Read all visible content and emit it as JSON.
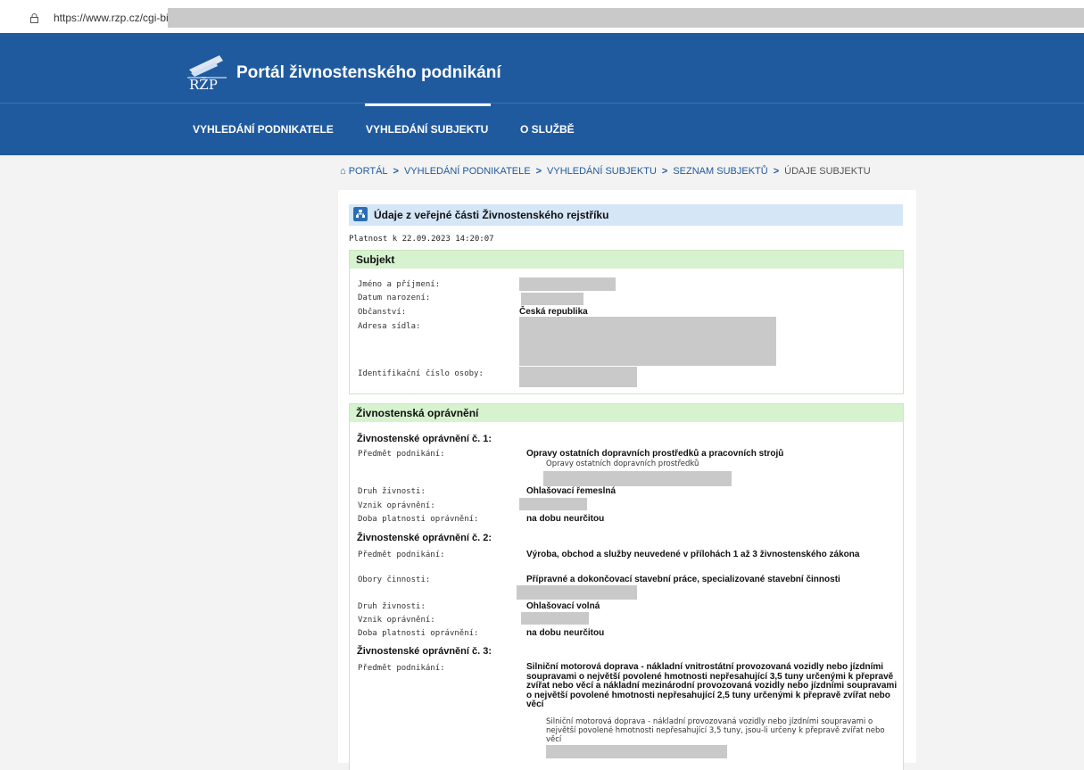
{
  "browser": {
    "url": "https://www.rzp.cz/cgi-bi"
  },
  "header": {
    "logo_text": "RŽP",
    "title": "Portál živnostenského podnikání"
  },
  "nav": {
    "items": [
      {
        "label": "VYHLEDÁNÍ PODNIKATELE",
        "active": false
      },
      {
        "label": "VYHLEDÁNÍ SUBJEKTU",
        "active": true
      },
      {
        "label": "O SLUŽBĚ",
        "active": false
      }
    ]
  },
  "breadcrumb": {
    "items": [
      "PORTÁL",
      "VYHLEDÁNÍ PODNIKATELE",
      "VYHLEDÁNÍ SUBJEKTU",
      "SEZNAM SUBJEKTŮ",
      "ÚDAJE SUBJEKTU"
    ],
    "separator": ">"
  },
  "card": {
    "title": "Údaje z veřejné části Živnostenského rejstříku",
    "validity": "Platnost k 22.09.2023 14:20:07"
  },
  "subject": {
    "heading": "Subjekt",
    "name_label": "Jméno a příjmení:",
    "birth_label": "Datum narození:",
    "citizenship_label": "Občanství:",
    "citizenship_value": "Česká republika",
    "address_label": "Adresa sídla:",
    "id_label": "Identifikační číslo osoby:"
  },
  "licenses": {
    "heading": "Živnostenská oprávnění",
    "items": [
      {
        "title": "Živnostenské oprávnění č. 1:",
        "subject_label": "Předmět podnikání:",
        "subject_value": "Opravy ostatních dopravních prostředků a pracovních strojů",
        "subject_sub": "Opravy ostatních dopravních prostředků",
        "type_label": "Druh živnosti:",
        "type_value": "Ohlašovací řemeslná",
        "origin_label": "Vznik oprávnění:",
        "duration_label": "Doba platnosti oprávnění:",
        "duration_value": "na dobu neurčitou"
      },
      {
        "title": "Živnostenské oprávnění č. 2:",
        "subject_label": "Předmět podnikání:",
        "subject_value": "Výroba, obchod a služby neuvedené v přílohách 1 až 3 živnostenského zákona",
        "fields_label": "Obory činnosti:",
        "fields_value": "Přípravné a dokončovací stavební práce, specializované stavební činnosti",
        "type_label": "Druh živnosti:",
        "type_value": "Ohlašovací volná",
        "origin_label": "Vznik oprávnění:",
        "duration_label": "Doba platnosti oprávnění:",
        "duration_value": "na dobu neurčitou"
      },
      {
        "title": "Živnostenské oprávnění č. 3:",
        "subject_label": "Předmět podnikání:",
        "subject_value": "Silniční motorová doprava - nákladní vnitrostátní provozovaná vozidly nebo jízdními soupravami o největší povolené hmotnosti nepřesahující 3,5 tuny určenými k přepravě zvířat nebo věcí a nákladní mezinárodní provozovaná vozidly nebo jízdními soupravami o největší povolené hmotnosti nepřesahující 2,5 tuny určenými k přepravě zvířat nebo věcí",
        "subject_sub": "Silniční motorová doprava - nákladní provozovaná vozidly nebo jízdními soupravami o největší povolené hmotnosti nepřesahující 3,5 tuny, jsou-li určeny k přepravě zvířat nebo věcí"
      }
    ]
  },
  "colors": {
    "header_blue": "#1f5a9e",
    "section_green": "#d6f2cf",
    "title_blue": "#d5e6f7",
    "redaction_gray": "#c9c9c9"
  }
}
